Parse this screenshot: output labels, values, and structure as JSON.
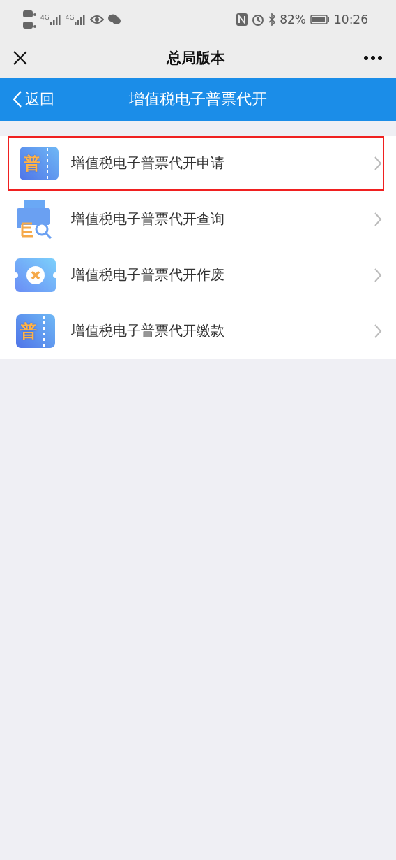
{
  "status_bar": {
    "network": [
      "4G",
      "4G"
    ],
    "battery_text": "82%",
    "time": "10:26"
  },
  "wechat_bar": {
    "title": "总局版本"
  },
  "header": {
    "back": "返回",
    "title": "增值税电子普票代开"
  },
  "items": [
    {
      "kind": "ticket",
      "icon_text": "普",
      "label": "增值税电子普票代开申请",
      "highlighted": true
    },
    {
      "kind": "search",
      "label": "增值税电子普票代开查询",
      "highlighted": false
    },
    {
      "kind": "cancel",
      "label": "增值税电子普票代开作废",
      "highlighted": false
    },
    {
      "kind": "ticket",
      "icon_text": "普",
      "label": "增值税电子普票代开缴款",
      "highlighted": false
    }
  ]
}
